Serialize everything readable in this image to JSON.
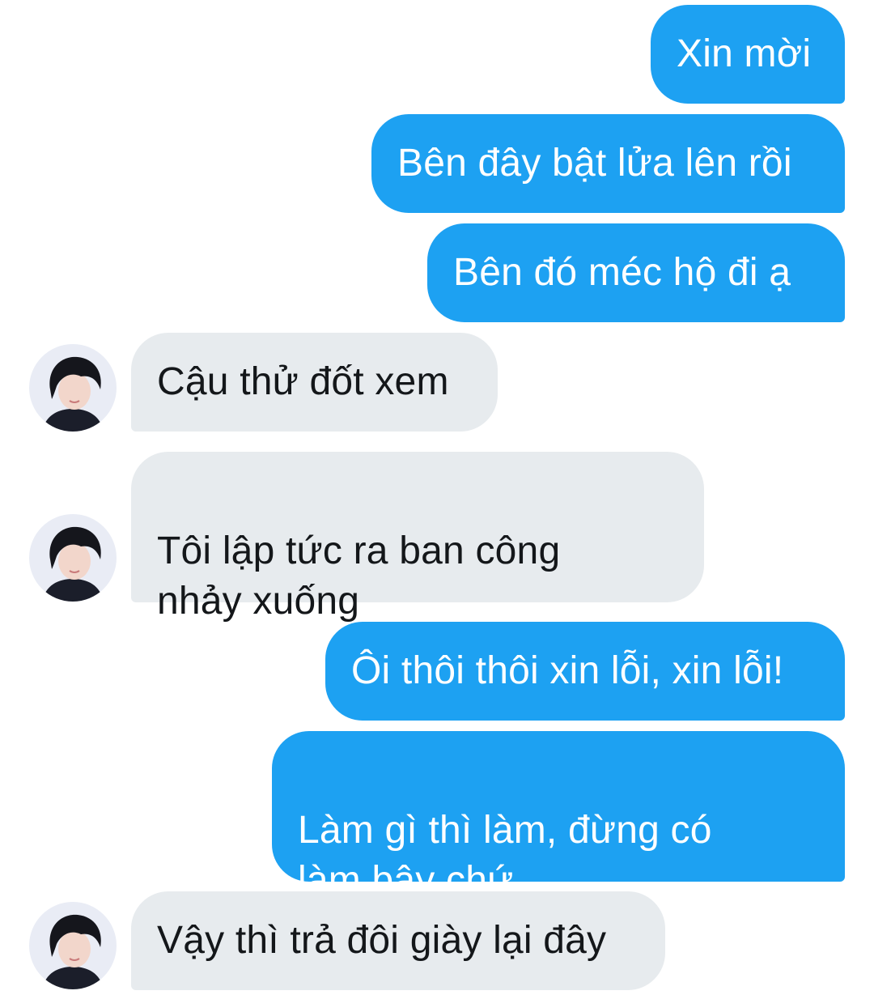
{
  "messages": [
    {
      "id": 1,
      "direction": "sent",
      "text": "Xin mời"
    },
    {
      "id": 2,
      "direction": "sent",
      "text": "Bên đây bật lửa lên rồi"
    },
    {
      "id": 3,
      "direction": "sent",
      "text": "Bên đó méc hộ đi ạ"
    },
    {
      "id": 4,
      "direction": "received",
      "text": "Cậu thử đốt xem"
    },
    {
      "id": 5,
      "direction": "received",
      "text": "Tôi lập tức ra ban công\nnhảy xuống"
    },
    {
      "id": 6,
      "direction": "sent",
      "text": "Ôi thôi thôi xin lỗi, xin lỗi!"
    },
    {
      "id": 7,
      "direction": "sent",
      "text": "Làm gì thì làm, đừng có\nlàm bậy chứ"
    },
    {
      "id": 8,
      "direction": "received",
      "text": "Vậy thì trả đôi giày lại đây"
    }
  ],
  "colors": {
    "sent_bubble": "#1da1f2",
    "sent_text": "#ffffff",
    "received_bubble": "#e7ebee",
    "received_text": "#14171a"
  },
  "icons": {
    "avatar": "contact-avatar-photo"
  }
}
